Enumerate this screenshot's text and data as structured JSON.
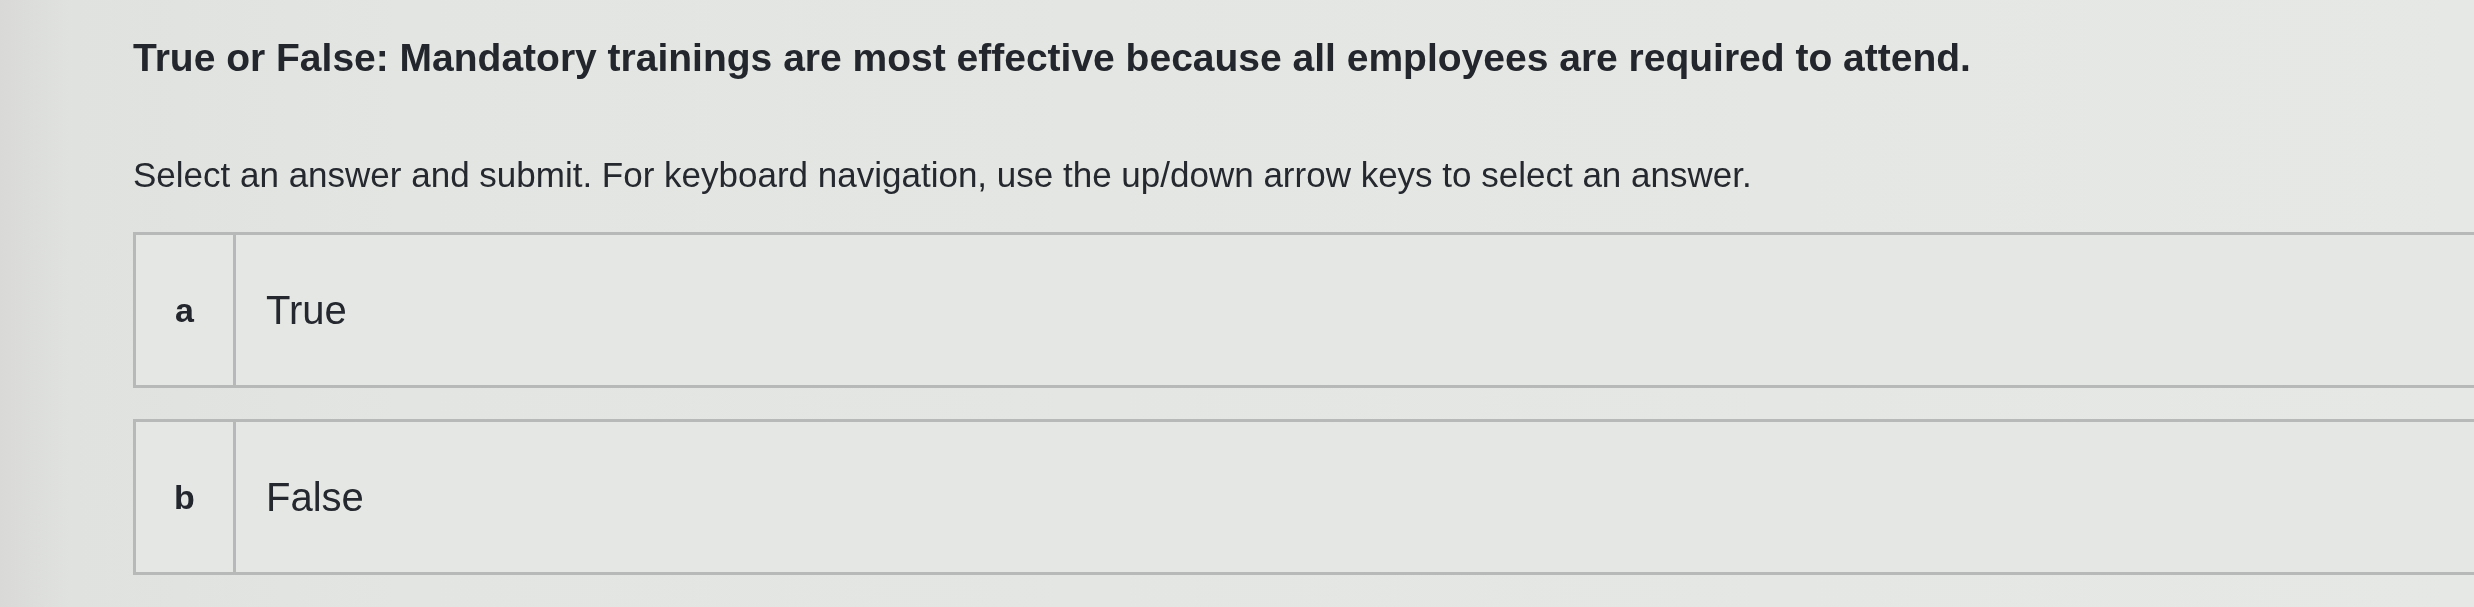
{
  "question": {
    "title": "True or False: Mandatory trainings are most effective because all employees are required to attend.",
    "instructions": "Select an answer and submit. For keyboard navigation, use the up/down arrow keys to select an answer."
  },
  "options": [
    {
      "letter": "a",
      "text": "True",
      "selected": false
    },
    {
      "letter": "b",
      "text": "False",
      "selected": false
    }
  ]
}
